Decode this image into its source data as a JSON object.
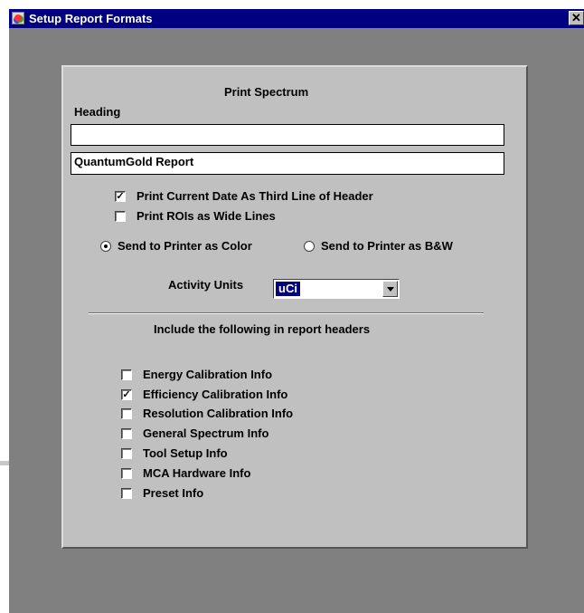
{
  "window": {
    "title": "Setup Report Formats",
    "close_label": "✕"
  },
  "print_spectrum": {
    "section_title": "Print Spectrum",
    "heading_label": "Heading",
    "heading_line1": "",
    "heading_line2": "QuantumGold Report"
  },
  "options": {
    "print_date": {
      "label": "Print Current Date As Third Line of Header",
      "checked": true
    },
    "print_rois": {
      "label": "Print ROIs as Wide Lines",
      "checked": false
    }
  },
  "printer_mode": {
    "color_label": "Send to Printer as Color",
    "bw_label": "Send to Printer as B&W",
    "selected": "color"
  },
  "activity_units": {
    "label": "Activity Units",
    "value": "uCi"
  },
  "report_headers": {
    "title": "Include the following in report headers",
    "items": [
      {
        "label": "Energy Calibration Info",
        "checked": false
      },
      {
        "label": "Efficiency Calibration Info",
        "checked": true
      },
      {
        "label": "Resolution Calibration Info",
        "checked": false
      },
      {
        "label": "General Spectrum Info",
        "checked": false
      },
      {
        "label": "Tool Setup Info",
        "checked": false
      },
      {
        "label": "MCA Hardware Info",
        "checked": false
      },
      {
        "label": "Preset Info",
        "checked": false
      }
    ]
  },
  "check_mark": "✓"
}
